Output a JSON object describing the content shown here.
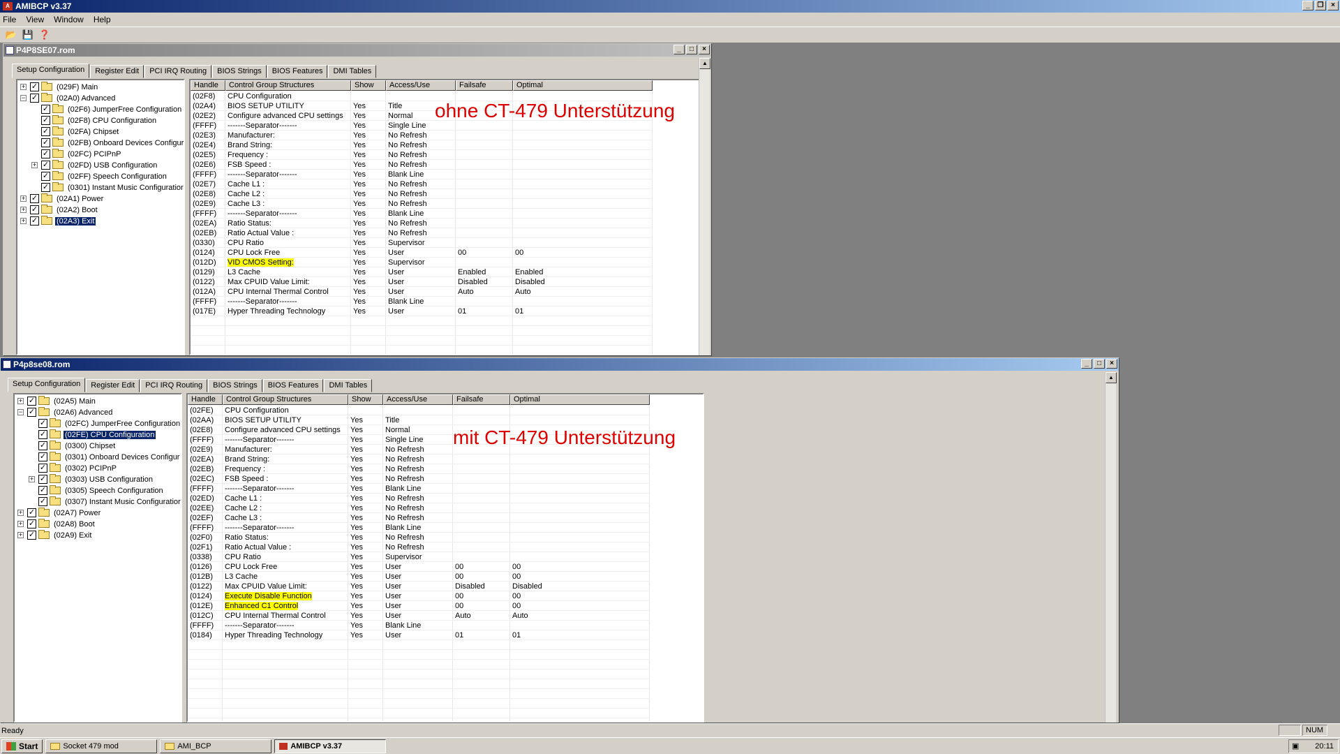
{
  "app": {
    "title": "AMIBCP v3.37",
    "menu": [
      "File",
      "View",
      "Window",
      "Help"
    ],
    "toolbar_icons": [
      "open-folder-icon",
      "save-icon",
      "help-icon"
    ]
  },
  "tabs": [
    "Setup Configuration",
    "Register Edit",
    "PCI IRQ Routing",
    "BIOS Strings",
    "BIOS Features",
    "DMI Tables"
  ],
  "columns": [
    "Handle",
    "Control Group Structures",
    "Show",
    "Access/Use",
    "Failsafe",
    "Optimal"
  ],
  "window1": {
    "title": "P4P8SE07.rom",
    "annotation": "ohne CT-479 Unterstützung",
    "tree": [
      {
        "label": "(029F) Main",
        "level": 0,
        "expander": "+"
      },
      {
        "label": "(02A0) Advanced",
        "level": 0,
        "expander": "-"
      },
      {
        "label": "(02F6) JumperFree Configuration",
        "level": 1,
        "expander": ""
      },
      {
        "label": "(02F8) CPU Configuration",
        "level": 1,
        "expander": ""
      },
      {
        "label": "(02FA) Chipset",
        "level": 1,
        "expander": ""
      },
      {
        "label": "(02FB) Onboard Devices Configur",
        "level": 1,
        "expander": ""
      },
      {
        "label": "(02FC) PCIPnP",
        "level": 1,
        "expander": ""
      },
      {
        "label": "(02FD) USB Configuration",
        "level": 1,
        "expander": "+"
      },
      {
        "label": "(02FF) Speech Configuration",
        "level": 1,
        "expander": ""
      },
      {
        "label": "(0301) Instant Music Configuratior",
        "level": 1,
        "expander": ""
      },
      {
        "label": "(02A1) Power",
        "level": 0,
        "expander": "+"
      },
      {
        "label": "(02A2) Boot",
        "level": 0,
        "expander": "+"
      },
      {
        "label": "(02A3) Exit",
        "level": 0,
        "expander": "+",
        "selected": true
      }
    ],
    "rows": [
      [
        "(02F8)",
        "CPU Configuration",
        "",
        "",
        "",
        ""
      ],
      [
        "(02A4)",
        "BIOS SETUP UTILITY",
        "Yes",
        "Title",
        "",
        ""
      ],
      [
        "(02E2)",
        "Configure advanced CPU settings",
        "Yes",
        "Normal",
        "",
        ""
      ],
      [
        "(FFFF)",
        "-------Separator-------",
        "Yes",
        "Single Line",
        "",
        ""
      ],
      [
        "(02E3)",
        "Manufacturer:",
        "Yes",
        "No Refresh",
        "",
        ""
      ],
      [
        "(02E4)",
        "Brand String:",
        "Yes",
        "No Refresh",
        "",
        ""
      ],
      [
        "(02E5)",
        "Frequency   :",
        "Yes",
        "No Refresh",
        "",
        ""
      ],
      [
        "(02E6)",
        "FSB Speed   :",
        "Yes",
        "No Refresh",
        "",
        ""
      ],
      [
        "(FFFF)",
        "-------Separator-------",
        "Yes",
        "Blank Line",
        "",
        ""
      ],
      [
        "(02E7)",
        "Cache L1    :",
        "Yes",
        "No Refresh",
        "",
        ""
      ],
      [
        "(02E8)",
        "Cache L2    :",
        "Yes",
        "No Refresh",
        "",
        ""
      ],
      [
        "(02E9)",
        "Cache L3    :",
        "Yes",
        "No Refresh",
        "",
        ""
      ],
      [
        "(FFFF)",
        "-------Separator-------",
        "Yes",
        "Blank Line",
        "",
        ""
      ],
      [
        "(02EA)",
        "Ratio Status:",
        "Yes",
        "No Refresh",
        "",
        ""
      ],
      [
        "(02EB)",
        "Ratio Actual Value  :",
        "Yes",
        "No Refresh",
        "",
        ""
      ],
      [
        "(0330)",
        "CPU Ratio",
        "Yes",
        "Supervisor",
        "",
        ""
      ],
      [
        "(0124)",
        "CPU Lock Free",
        "Yes",
        "User",
        "00",
        "00"
      ],
      [
        "(012D)",
        "  VID CMOS Setting:",
        "Yes",
        "Supervisor",
        "",
        ""
      ],
      [
        "(0129)",
        "L3 Cache",
        "Yes",
        "User",
        "Enabled",
        "Enabled"
      ],
      [
        "(0122)",
        "Max CPUID Value Limit:",
        "Yes",
        "User",
        "Disabled",
        "Disabled"
      ],
      [
        "(012A)",
        "CPU Internal Thermal Control",
        "Yes",
        "User",
        "Auto",
        "Auto"
      ],
      [
        "(FFFF)",
        "-------Separator-------",
        "Yes",
        "Blank Line",
        "",
        ""
      ],
      [
        "(017E)",
        "Hyper Threading Technology",
        "Yes",
        "User",
        "01",
        "01"
      ]
    ],
    "highlight_rows": [
      17
    ]
  },
  "window2": {
    "title": "P4p8se08.rom",
    "annotation": "mit CT-479 Unterstützung",
    "tree": [
      {
        "label": "(02A5) Main",
        "level": 0,
        "expander": "+"
      },
      {
        "label": "(02A6) Advanced",
        "level": 0,
        "expander": "-"
      },
      {
        "label": "(02FC) JumperFree Configuration",
        "level": 1,
        "expander": ""
      },
      {
        "label": "(02FE) CPU Configuration",
        "level": 1,
        "expander": "",
        "selected": true
      },
      {
        "label": "(0300) Chipset",
        "level": 1,
        "expander": ""
      },
      {
        "label": "(0301) Onboard Devices Configur",
        "level": 1,
        "expander": ""
      },
      {
        "label": "(0302) PCIPnP",
        "level": 1,
        "expander": ""
      },
      {
        "label": "(0303) USB Configuration",
        "level": 1,
        "expander": "+"
      },
      {
        "label": "(0305) Speech Configuration",
        "level": 1,
        "expander": ""
      },
      {
        "label": "(0307) Instant Music Configuratior",
        "level": 1,
        "expander": ""
      },
      {
        "label": "(02A7) Power",
        "level": 0,
        "expander": "+"
      },
      {
        "label": "(02A8) Boot",
        "level": 0,
        "expander": "+"
      },
      {
        "label": "(02A9) Exit",
        "level": 0,
        "expander": "+"
      }
    ],
    "rows": [
      [
        "(02FE)",
        "CPU Configuration",
        "",
        "",
        "",
        ""
      ],
      [
        "(02AA)",
        "BIOS SETUP UTILITY",
        "Yes",
        "Title",
        "",
        ""
      ],
      [
        "(02E8)",
        "Configure advanced CPU settings",
        "Yes",
        "Normal",
        "",
        ""
      ],
      [
        "(FFFF)",
        "-------Separator-------",
        "Yes",
        "Single Line",
        "",
        ""
      ],
      [
        "(02E9)",
        "Manufacturer:",
        "Yes",
        "No Refresh",
        "",
        ""
      ],
      [
        "(02EA)",
        "Brand String:",
        "Yes",
        "No Refresh",
        "",
        ""
      ],
      [
        "(02EB)",
        "Frequency   :",
        "Yes",
        "No Refresh",
        "",
        ""
      ],
      [
        "(02EC)",
        "FSB Speed   :",
        "Yes",
        "No Refresh",
        "",
        ""
      ],
      [
        "(FFFF)",
        "-------Separator-------",
        "Yes",
        "Blank Line",
        "",
        ""
      ],
      [
        "(02ED)",
        "Cache L1    :",
        "Yes",
        "No Refresh",
        "",
        ""
      ],
      [
        "(02EE)",
        "Cache L2    :",
        "Yes",
        "No Refresh",
        "",
        ""
      ],
      [
        "(02EF)",
        "Cache L3    :",
        "Yes",
        "No Refresh",
        "",
        ""
      ],
      [
        "(FFFF)",
        "-------Separator-------",
        "Yes",
        "Blank Line",
        "",
        ""
      ],
      [
        "(02F0)",
        "Ratio Status:",
        "Yes",
        "No Refresh",
        "",
        ""
      ],
      [
        "(02F1)",
        "Ratio Actual Value  :",
        "Yes",
        "No Refresh",
        "",
        ""
      ],
      [
        "(0338)",
        "CPU Ratio",
        "Yes",
        "Supervisor",
        "",
        ""
      ],
      [
        "(0126)",
        "CPU Lock Free",
        "Yes",
        "User",
        "00",
        "00"
      ],
      [
        "(012B)",
        "L3 Cache",
        "Yes",
        "User",
        "00",
        "00"
      ],
      [
        "(0122)",
        "Max CPUID Value Limit:",
        "Yes",
        "User",
        "Disabled",
        "Disabled"
      ],
      [
        "(0124)",
        "Execute Disable Function",
        "Yes",
        "User",
        "00",
        "00"
      ],
      [
        "(012E)",
        "Enhanced C1 Control",
        "Yes",
        "User",
        "00",
        "00"
      ],
      [
        "(012C)",
        "CPU Internal Thermal Control",
        "Yes",
        "User",
        "Auto",
        "Auto"
      ],
      [
        "(FFFF)",
        "-------Separator-------",
        "Yes",
        "Blank Line",
        "",
        ""
      ],
      [
        "(0184)",
        "Hyper Threading Technology",
        "Yes",
        "User",
        "01",
        "01"
      ]
    ],
    "highlight_rows": [
      19,
      20
    ]
  },
  "status": {
    "text": "Ready",
    "num": "NUM"
  },
  "taskbar": {
    "start": "Start",
    "items": [
      "Socket 479 mod",
      "AMI_BCP",
      "AMIBCP v3.37"
    ],
    "active_index": 2,
    "clock": "20:11"
  },
  "colors": {
    "title_active": "#0a246a",
    "highlight": "#ffff00",
    "annotation": "#e00000",
    "selection": "#0a246a"
  }
}
